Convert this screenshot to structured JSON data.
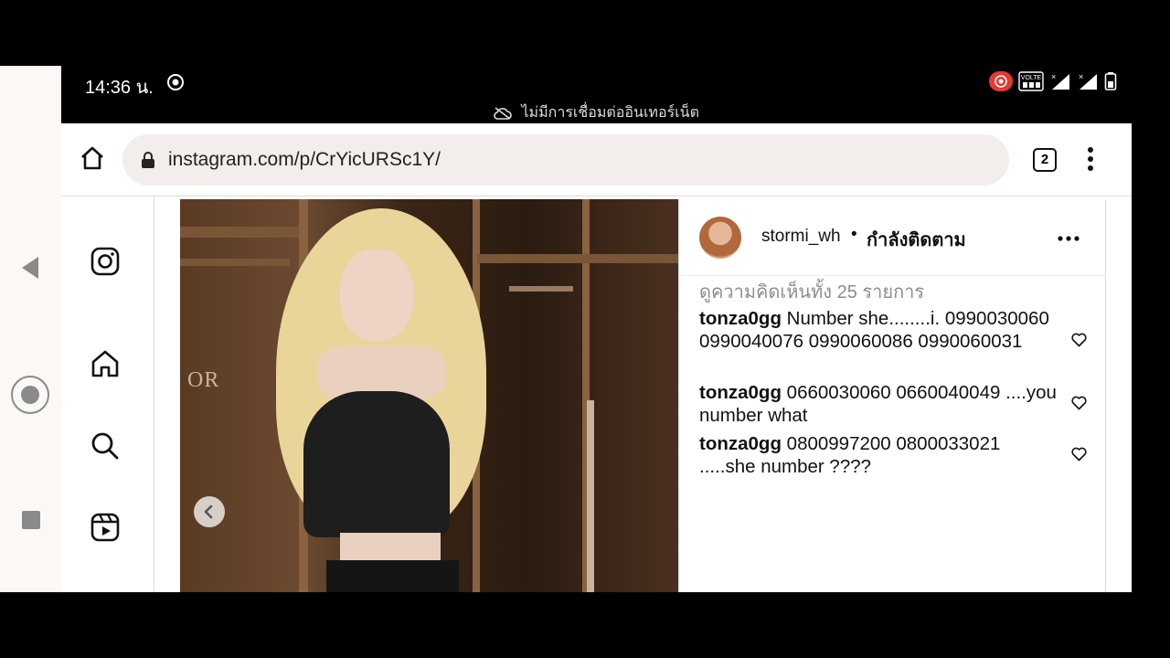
{
  "status_bar": {
    "time": "14:36 น.",
    "offline_text": "ไม่มีการเชื่อมต่ออินเทอร์เน็ต",
    "volte_label": "VOLTE"
  },
  "browser": {
    "url": "instagram.com/p/CrYicURSc1Y/",
    "tab_count": "2"
  },
  "post": {
    "username": "stormi_wh",
    "separator": "•",
    "follow_status": "กำลังติดตาม",
    "view_all_comments": "ดูความคิดเห็นทั้ง 25 รายการ",
    "comments": [
      {
        "user": "tonza0gg",
        "text": "Number she........i. 0990030060 0990040076 0990060086 0990060031"
      },
      {
        "user": "tonza0gg",
        "text": "0660030060 0660040049 ....you number what"
      },
      {
        "user": "tonza0gg",
        "text": "0800997200 0800033021 .....she number ????"
      }
    ]
  },
  "photo_backdrop_text": "OR",
  "icons": {
    "sidebar": [
      "instagram-icon",
      "home-icon",
      "search-icon",
      "reels-icon"
    ],
    "android_nav": [
      "back-icon",
      "home-circle-icon",
      "recents-icon"
    ]
  },
  "colors": {
    "accent_red": "#e53935",
    "secondary_text": "#8e8e8e"
  }
}
